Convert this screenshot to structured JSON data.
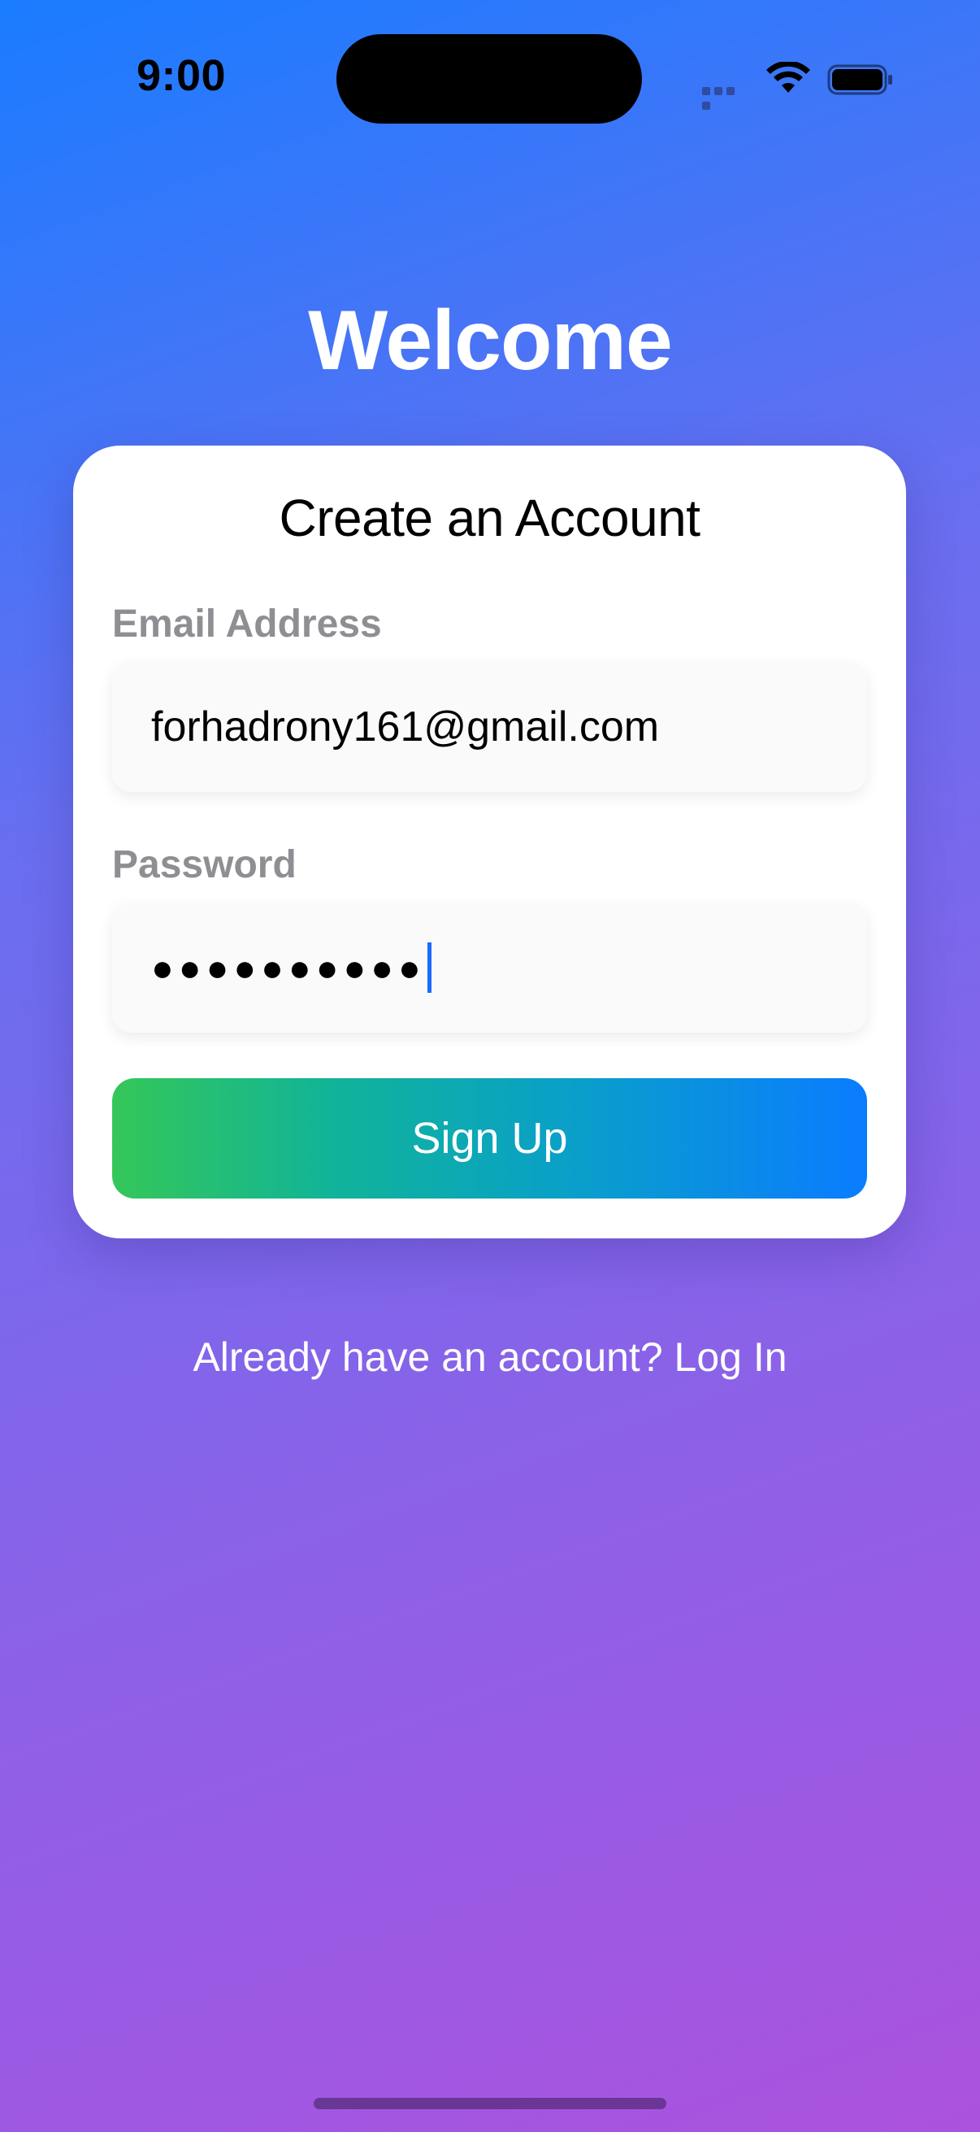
{
  "status_bar": {
    "time": "9:00",
    "icons": [
      "signal-icon",
      "wifi-icon",
      "battery-icon"
    ]
  },
  "screen": {
    "title": "Welcome"
  },
  "form": {
    "title": "Create an Account",
    "email": {
      "label": "Email Address",
      "value": "forhadrony161@gmail.com"
    },
    "password": {
      "label": "Password",
      "masked_value": "●●●●●●●●●●"
    },
    "submit_label": "Sign Up"
  },
  "footer": {
    "login_prompt": "Already have an account? Log In"
  },
  "colors": {
    "background_start": "#1a7cff",
    "background_end": "#ab52de",
    "button_start": "#34c759",
    "button_end": "#0a7cff",
    "label_gray": "#8e8e93",
    "caret": "#1a6cff"
  }
}
